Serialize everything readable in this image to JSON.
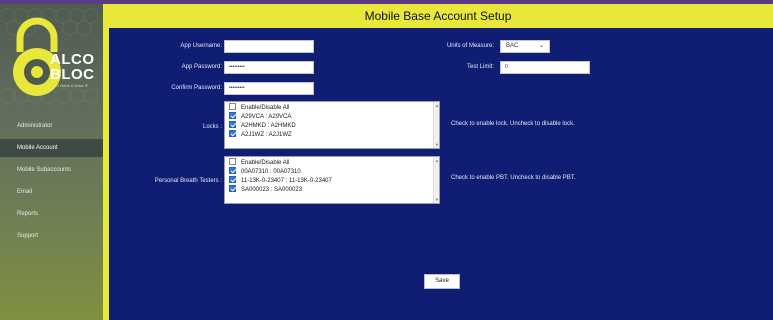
{
  "brand": {
    "line1": "ALCO",
    "line2": "BLOC",
    "tagline": "Don't Drink & Drive ®"
  },
  "sidebar": {
    "items": [
      {
        "label": "Administrator",
        "active": false
      },
      {
        "label": "Mobile Account",
        "active": true
      },
      {
        "label": "Mobile Subaccounts",
        "active": false
      },
      {
        "label": "Email",
        "active": false
      },
      {
        "label": "Reports",
        "active": false
      },
      {
        "label": "Support",
        "active": false
      }
    ]
  },
  "header": {
    "title": "Mobile Base Account Setup"
  },
  "form": {
    "username_label": "App Username:",
    "username_value": "",
    "password_label": "App Password:",
    "password_value": "•••••••••",
    "confirm_label": "Confirm Password:",
    "confirm_value": "•••••••••",
    "units_label": "Units of Measure:",
    "units_value": "BAC",
    "test_limit_label": "Test Limit:",
    "test_limit_value": "0",
    "locks_label": "Locks :",
    "locks_hint": "Check to enable lock. Uncheck to disable lock.",
    "locks": [
      {
        "label": "Enable/Disable All",
        "checked": false
      },
      {
        "label": "A29VCA : A29VCA",
        "checked": true
      },
      {
        "label": "A2HMKD : A2HMKD",
        "checked": true
      },
      {
        "label": "A2J1WZ : A2J1WZ",
        "checked": true
      }
    ],
    "pbt_label": "Personal Breath Testers :",
    "pbt_hint": "Check to enable PBT. Uncheck to disable PBT.",
    "pbts": [
      {
        "label": "Enable/Disable All",
        "checked": false
      },
      {
        "label": "00A07310 : 00A07310",
        "checked": true
      },
      {
        "label": "11-13K-0-23407 : 11-13K-0-23407",
        "checked": true
      },
      {
        "label": "SA000023 : SA000023",
        "checked": true
      }
    ],
    "save_label": "Save"
  },
  "colors": {
    "main_bg": "#0f1d73",
    "title_bar": "#e8e83a",
    "checkbox_on": "#3a74d8"
  }
}
